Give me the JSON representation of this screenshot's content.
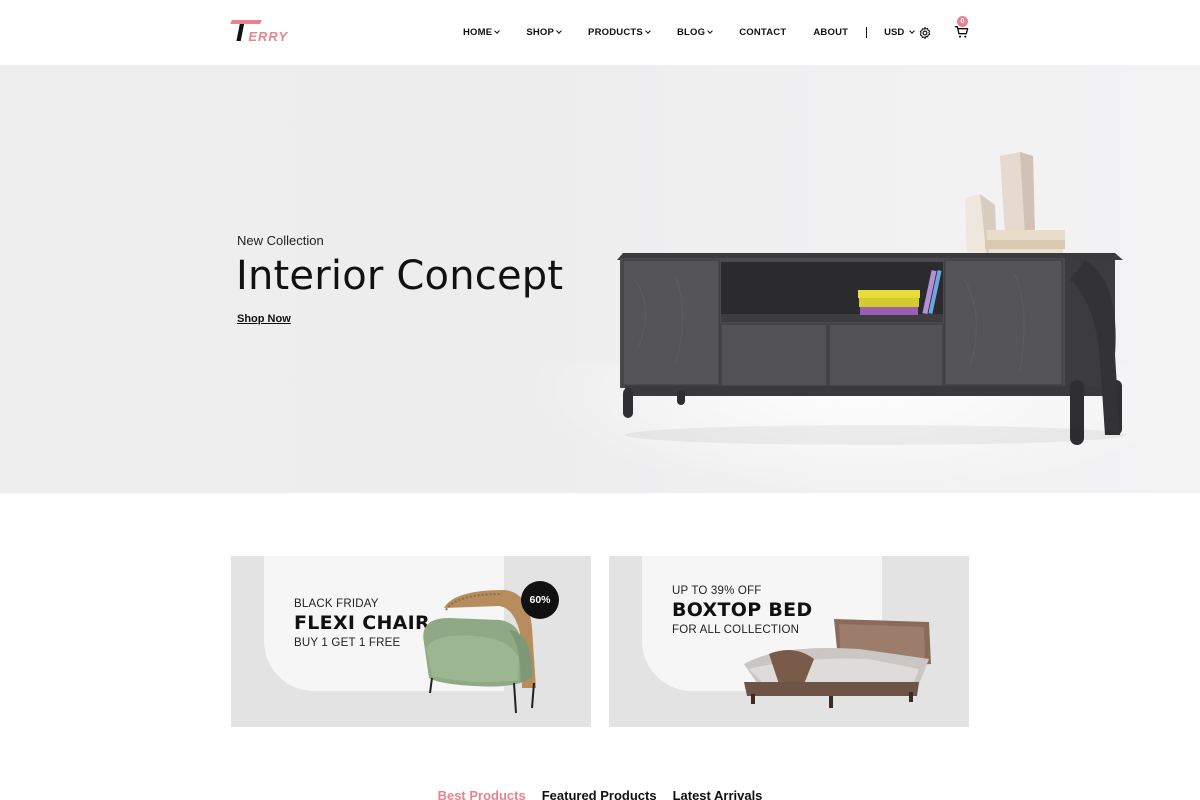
{
  "brand": {
    "logo_mark": "T",
    "logo_rest": "ERRY",
    "accent": "#e8838f"
  },
  "nav": {
    "items": [
      {
        "label": "HOME",
        "has_dropdown": true
      },
      {
        "label": "SHOP",
        "has_dropdown": true
      },
      {
        "label": "PRODUCTS",
        "has_dropdown": true
      },
      {
        "label": "BLOG",
        "has_dropdown": true
      },
      {
        "label": "CONTACT",
        "has_dropdown": false
      },
      {
        "label": "ABOUT",
        "has_dropdown": false
      }
    ],
    "currency": "USD",
    "settings_icon": "gear-icon",
    "cart_icon": "cart-icon",
    "cart_count": "0"
  },
  "hero": {
    "subtitle": "New Collection",
    "title": "Interior Concept",
    "cta": "Shop Now"
  },
  "banners": [
    {
      "eyebrow": "BLACK FRIDAY",
      "title": "FLEXI CHAIR",
      "subtitle": "BUY 1 GET 1 FREE",
      "badge": "60%"
    },
    {
      "eyebrow": "UP TO 39% OFF",
      "title": "BOXTOP BED",
      "subtitle": "FOR ALL COLLECTION"
    }
  ],
  "product_tabs": [
    {
      "label": "Best Products",
      "active": true
    },
    {
      "label": "Featured Products",
      "active": false
    },
    {
      "label": "Latest Arrivals",
      "active": false
    }
  ]
}
